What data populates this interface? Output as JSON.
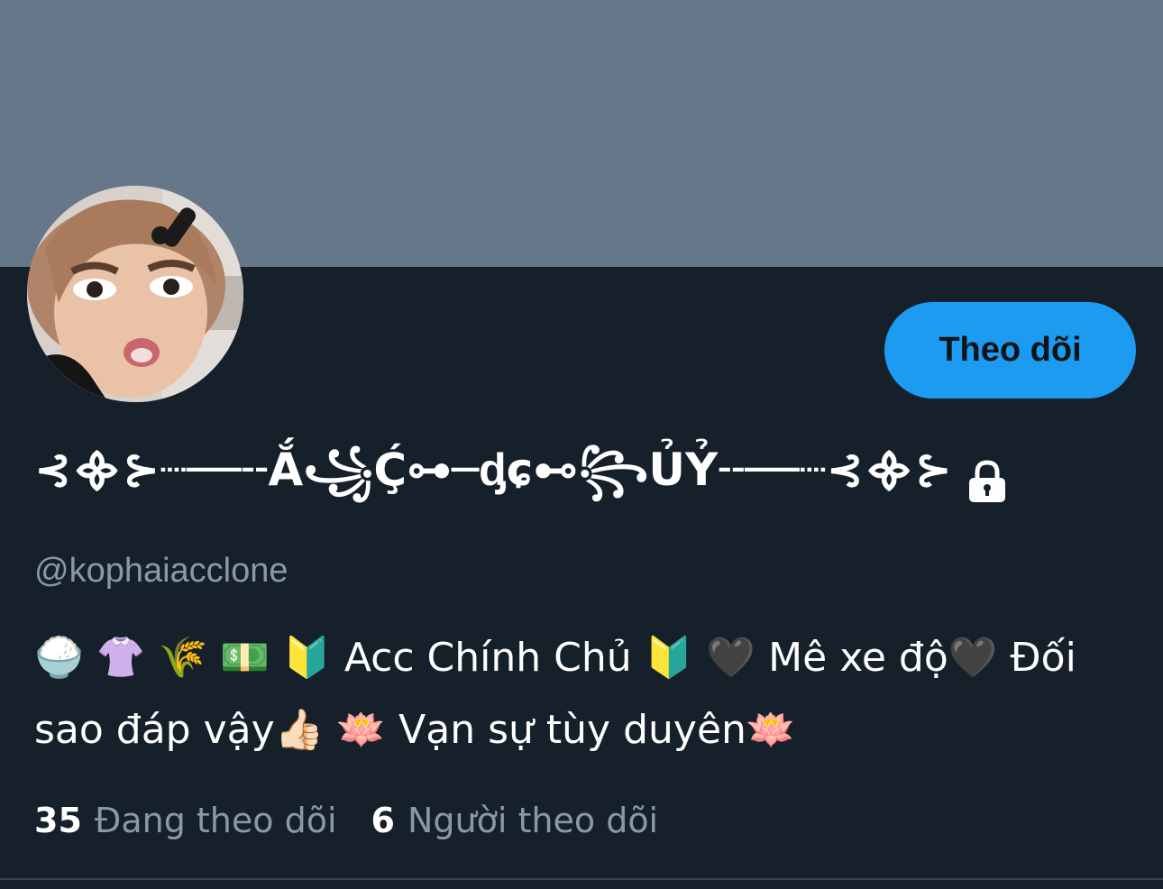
{
  "profile": {
    "display_name": "⊰᯽⊱┈──╌Ắ꧁Ḉ⊶─ᶁɕ⊷꧂ỦỶ╌──┈⊰᯽⊱",
    "handle": "@kophaiacclone",
    "bio": "🍚 👚 🌾 💵 🔰 Acc Chính Chủ 🔰 🖤 Mê xe độ🖤 Đối sao đáp vậy👍🏻 🪷 Vạn sự tùy duyên🪷",
    "follow_button_label": "Theo dõi",
    "following_count": "35",
    "following_label": "Đang theo dõi",
    "followers_count": "6",
    "followers_label": "Người theo dõi",
    "locked_icon": "lock-icon"
  },
  "colors": {
    "background": "#15202b",
    "banner": "#66778a",
    "accent": "#1d9bf0",
    "muted_text": "#8b98a5",
    "primary_text": "#ffffff"
  }
}
